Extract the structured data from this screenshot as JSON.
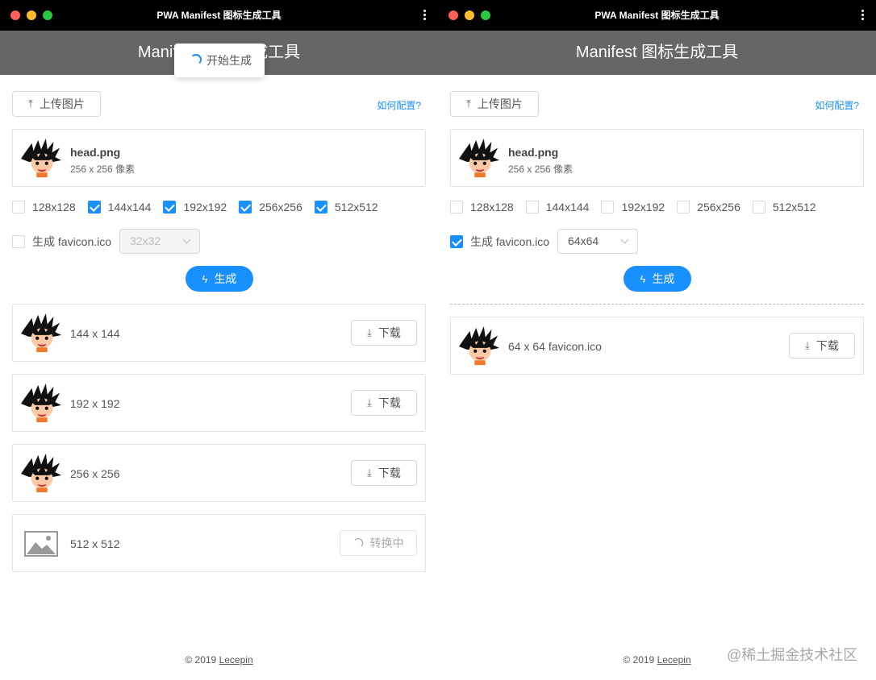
{
  "title_bar": {
    "title": "PWA Manifest 图标生成工具"
  },
  "header": {
    "title": "Manifest 图标生成工具"
  },
  "toast": {
    "text": "开始生成"
  },
  "upload_button": {
    "label": "上传图片"
  },
  "help_link": {
    "label": "如何配置?"
  },
  "file": {
    "name": "head.png",
    "dimensions": "256 x 256 像素"
  },
  "favicon_label": "生成 favicon.ico",
  "generate_button": {
    "label": "生成"
  },
  "download_label": "下载",
  "converting_label": "转换中",
  "footer": {
    "copyright": "© 2019",
    "author": "Lecepin"
  },
  "watermark": "@稀土掘金技术社区",
  "colors": {
    "accent": "#1890ff",
    "header_bg": "#666666",
    "title_bar_bg": "#000000"
  },
  "left_window": {
    "sizes": [
      {
        "label": "128x128",
        "checked": false
      },
      {
        "label": "144x144",
        "checked": true
      },
      {
        "label": "192x192",
        "checked": true
      },
      {
        "label": "256x256",
        "checked": true
      },
      {
        "label": "512x512",
        "checked": true
      }
    ],
    "favicon_checked": false,
    "favicon_size": "32x32",
    "favicon_select_disabled": true,
    "results": [
      {
        "label": "144 x 144",
        "status": "ready"
      },
      {
        "label": "192 x 192",
        "status": "ready"
      },
      {
        "label": "256 x 256",
        "status": "ready"
      },
      {
        "label": "512 x 512",
        "status": "converting"
      }
    ]
  },
  "right_window": {
    "sizes": [
      {
        "label": "128x128",
        "checked": false
      },
      {
        "label": "144x144",
        "checked": false
      },
      {
        "label": "192x192",
        "checked": false
      },
      {
        "label": "256x256",
        "checked": false
      },
      {
        "label": "512x512",
        "checked": false
      }
    ],
    "favicon_checked": true,
    "favicon_size": "64x64",
    "favicon_select_disabled": false,
    "results": [
      {
        "label": "64 x 64 favicon.ico",
        "status": "ready"
      }
    ]
  }
}
